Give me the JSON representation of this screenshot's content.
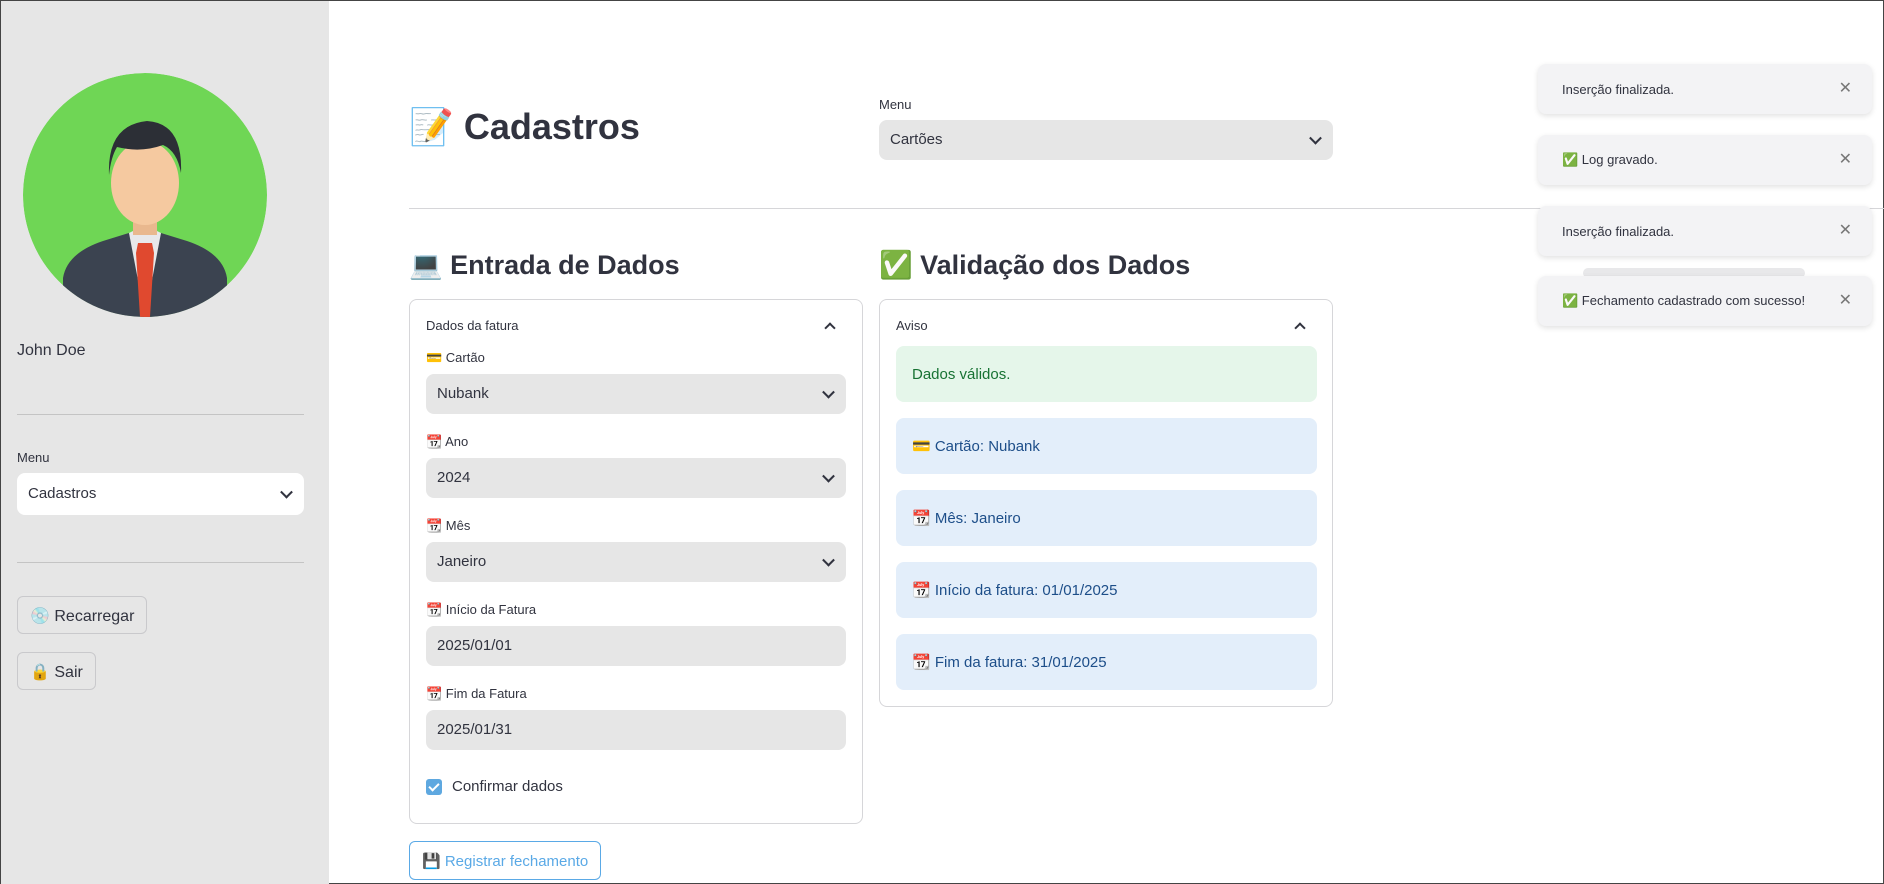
{
  "sidebar": {
    "user_name": "John Doe",
    "menu_label": "Menu",
    "menu_value": "Cadastros",
    "reload_button": "💿 Recarregar",
    "logout_button": "🔒 Sair"
  },
  "header": {
    "title": "📝 Cadastros",
    "menu_label": "Menu",
    "menu_value": "Cartões"
  },
  "input_section": {
    "title": "💻 Entrada de Dados",
    "panel_title": "Dados da fatura",
    "fields": [
      {
        "label": "💳 Cartão",
        "value": "Nubank"
      },
      {
        "label": "📆 Ano",
        "value": "2024"
      },
      {
        "label": "📆 Mês",
        "value": "Janeiro"
      },
      {
        "label": "📆 Início da Fatura",
        "value": "2025/01/01"
      },
      {
        "label": "📆 Fim da Fatura",
        "value": "2025/01/31"
      }
    ],
    "confirm_label": "Confirmar dados",
    "register_button": "💾 Registrar fechamento"
  },
  "validation_section": {
    "title": "✅ Validação dos Dados",
    "panel_title": "Aviso",
    "success_text": "Dados válidos.",
    "info_items": [
      "💳 Cartão: Nubank",
      "📆 Mês: Janeiro",
      "📆 Início da fatura: 01/01/2025",
      "📆 Fim da fatura: 31/01/2025"
    ]
  },
  "toasts": [
    "Inserção finalizada.",
    "✅ Log gravado.",
    "Inserção finalizada.",
    "✅ Fechamento cadastrado com sucesso!"
  ],
  "colors": {
    "sidebar_bg": "#e6e6e6",
    "accent": "#5aa9e6",
    "success_bg": "#e5f6ea",
    "info_bg": "#e3eefa"
  }
}
